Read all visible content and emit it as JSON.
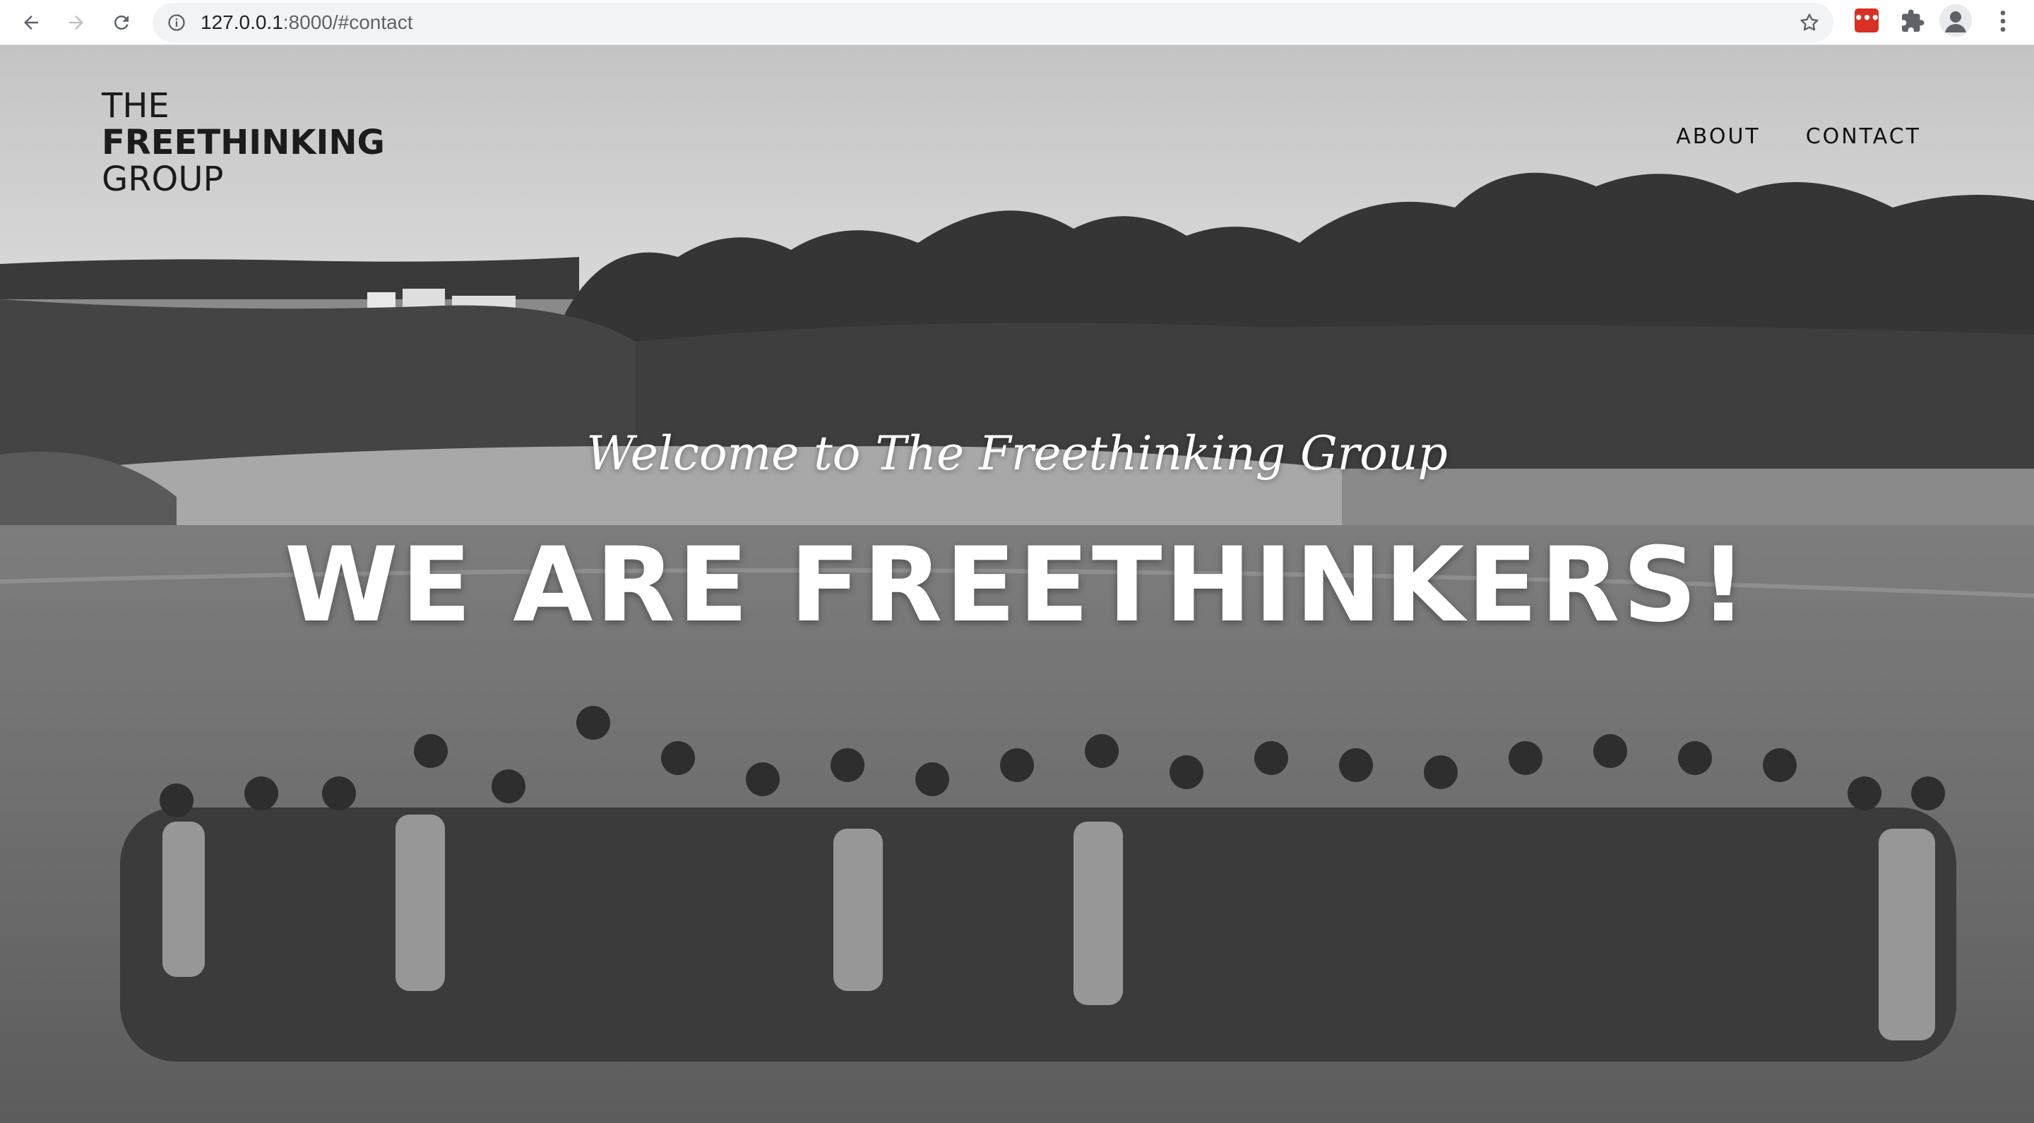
{
  "browser": {
    "url_host": "127.0.0.1",
    "url_rest": ":8000/#contact",
    "icons": {
      "back": "back-arrow-icon",
      "forward": "forward-arrow-icon",
      "reload": "reload-icon",
      "info": "info-icon",
      "bookmark": "star-icon",
      "extension": "extension-red-icon",
      "extensions": "puzzle-icon",
      "profile": "profile-icon",
      "menu": "kebab-menu-icon"
    },
    "extension_badge": "•••"
  },
  "site": {
    "logo": {
      "line1": "THE",
      "line2": "FREETHINKING",
      "line3": "GROUP"
    },
    "nav": [
      {
        "label": "ABOUT"
      },
      {
        "label": "CONTACT"
      }
    ],
    "hero": {
      "welcome": "Welcome to The Freethinking Group",
      "headline": "WE ARE FREETHINKERS!"
    }
  },
  "colors": {
    "text_on_hero": "#ffffff",
    "logo_text": "#1c1c1c",
    "nav_text": "#111111"
  }
}
